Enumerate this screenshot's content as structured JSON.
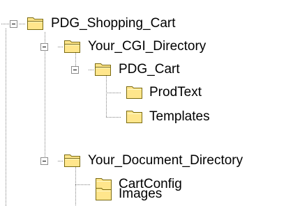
{
  "tree": {
    "root": {
      "label": "PDG_Shopping_Cart",
      "expanded": true,
      "icon": "folder-icon",
      "children": {
        "cgi": {
          "label": "Your_CGI_Directory",
          "expanded": true,
          "icon": "folder-icon",
          "children": {
            "pdg_cart": {
              "label": "PDG_Cart",
              "expanded": true,
              "icon": "folder-icon",
              "children": {
                "prodtext": {
                  "label": "ProdText",
                  "icon": "folder-icon"
                },
                "templates": {
                  "label": "Templates",
                  "icon": "folder-icon"
                }
              }
            }
          }
        },
        "docs": {
          "label": "Your_Document_Directory",
          "expanded": true,
          "icon": "folder-icon",
          "children": {
            "cartconfig": {
              "label": "CartConfig",
              "icon": "folder-icon"
            },
            "images": {
              "label": "Images",
              "icon": "folder-icon"
            }
          }
        }
      }
    }
  },
  "colors": {
    "folder_fill": "#ffe68c",
    "folder_outline": "#7a6a10",
    "tree_lines": "#808080",
    "toggle_border": "#8c8c8c"
  }
}
